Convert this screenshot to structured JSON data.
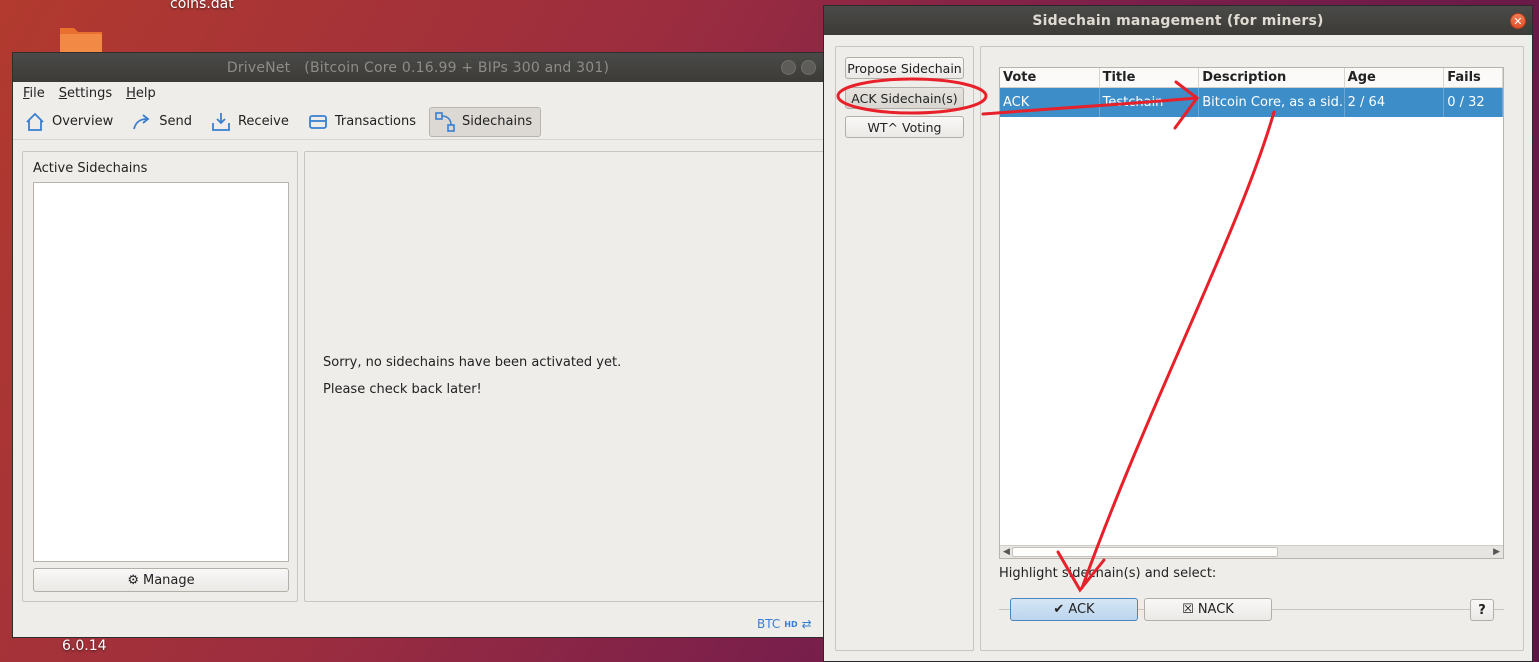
{
  "desktop": {
    "file_label": "coins.dat",
    "version_label": "6.0.14"
  },
  "drivenet": {
    "title": "DriveNet   (Bitcoin Core 0.16.99 + BIPs 300 and 301)",
    "menu": [
      "File",
      "Settings",
      "Help"
    ],
    "toolbar": [
      "Overview",
      "Send",
      "Receive",
      "Transactions",
      "Sidechains"
    ],
    "active_sidechains_label": "Active Sidechains",
    "manage_label": "Manage",
    "message_line1": "Sorry, no sidechains have been activated yet.",
    "message_line2": "Please check back later!",
    "status_unit": "BTC",
    "status_hd": "HD"
  },
  "dialog": {
    "title": "Sidechain management (for miners)",
    "side_buttons": [
      "Propose Sidechain",
      "ACK Sidechain(s)",
      "WT^ Voting"
    ],
    "columns": [
      "Vote",
      "Title",
      "Description",
      "Age",
      "Fails"
    ],
    "rows": [
      {
        "vote": "ACK",
        "title": "Testchain",
        "description": "Bitcoin Core, as a sid...",
        "age": "2 / 64",
        "fails": "0 / 32"
      }
    ],
    "hint": "Highlight sidechain(s) and select:",
    "ack_label": "ACK",
    "nack_label": "NACK",
    "help_label": "?"
  },
  "colors": {
    "selection": "#3d8dc8",
    "annotation": "#e8202a",
    "accent": "#3a7fd0"
  }
}
